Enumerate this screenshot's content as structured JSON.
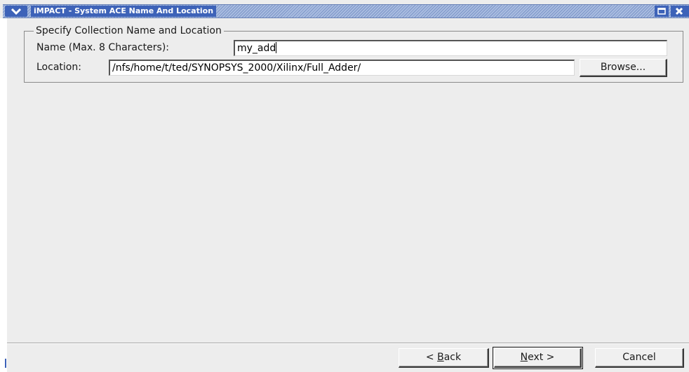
{
  "window": {
    "title": "iMPACT - System ACE Name And Location",
    "titlebar_color": "#3d62b8",
    "icons": {
      "menu": "chevron-down-icon",
      "maximize": "maximize-icon",
      "close": "close-icon"
    }
  },
  "group": {
    "legend": "Specify Collection Name and Location"
  },
  "name_field": {
    "label": "Name (Max. 8 Characters):",
    "value": "my_add"
  },
  "location_field": {
    "label": "Location:",
    "value": "/nfs/home/t/ted/SYNOPSYS_2000/Xilinx/Full_Adder/"
  },
  "buttons": {
    "browse": "Browse...",
    "back_prefix": "< ",
    "back_mnemonic": "B",
    "back_rest": "ack",
    "next_mnemonic": "N",
    "next_rest": "ext >",
    "cancel": "Cancel"
  }
}
